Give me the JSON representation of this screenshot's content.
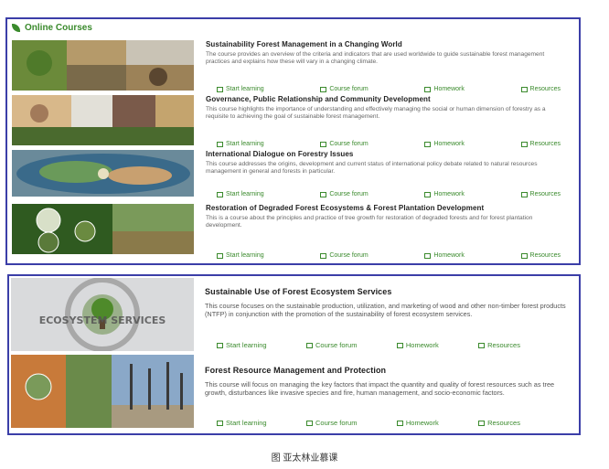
{
  "header": {
    "title": "Online Courses"
  },
  "links": {
    "start": "Start learning",
    "forum": "Course forum",
    "homework": "Homework",
    "resources": "Resources"
  },
  "courses": [
    {
      "title": "Sustainability Forest Management in a Changing World",
      "desc": "The course provides an overview of the criteria and indicators that are used worldwide to guide sustainable forest management practices and explains how these will vary in a changing climate."
    },
    {
      "title": "Governance, Public Relationship and Community Development",
      "desc": "This course highlights the importance of understanding and effectively managing the social or human dimension of forestry as a requisite to achieving the goal of sustainable forest management."
    },
    {
      "title": "International Dialogue on Forestry Issues",
      "desc": "This course addresses the origins, development and current status of international policy debate related to natural resources management in general and forests in particular."
    },
    {
      "title": "Restoration of Degraded Forest Ecosystems & Forest Plantation Development",
      "desc": "This is a course about the principles and practice of tree growth for restoration of degraded forests and for forest plantation development."
    },
    {
      "title": "Sustainable Use of Forest Ecosystem Services",
      "desc": "This course focuses on the sustainable production, utilization, and marketing of wood and other non-timber forest products (NTFP) in conjunction with the promotion of the sustainability of forest ecosystem services.",
      "thumb_text": "ECOSYSTEM SERVICES"
    },
    {
      "title": "Forest Resource Management and Protection",
      "desc": "This course will focus on managing the key factors that impact the quantity and quality of forest resources such as tree growth, disturbances like invasive species and fire, human management, and socio-economic factors."
    }
  ],
  "caption": "图 亚太林业慕课",
  "colors": {
    "accent": "#3a8a2c",
    "border": "#3b3ea8"
  }
}
